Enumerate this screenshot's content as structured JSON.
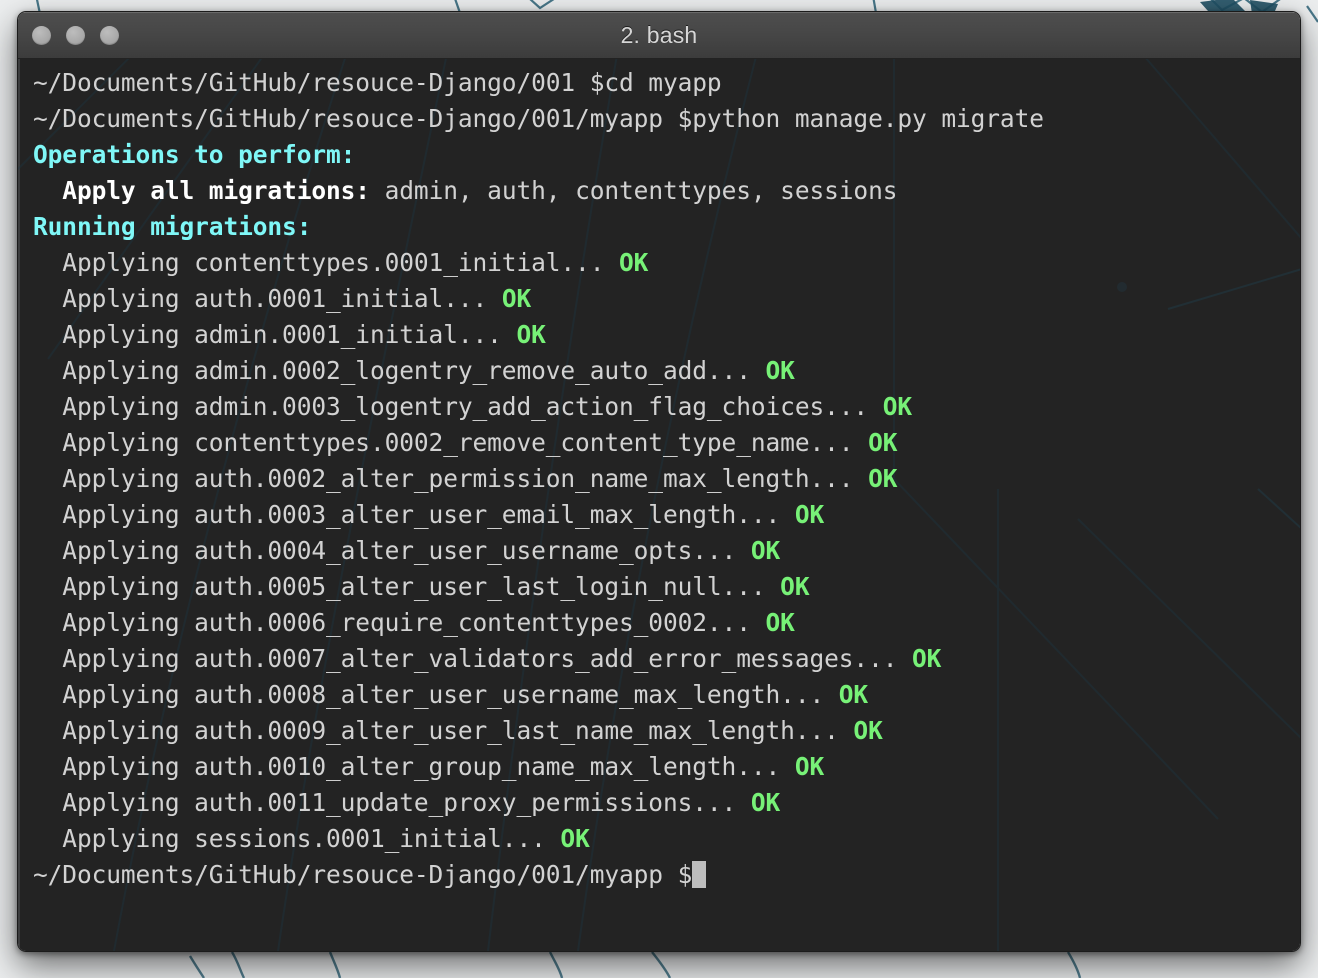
{
  "window": {
    "title": "2. bash",
    "controls": [
      {
        "name": "close-button",
        "label": "close"
      },
      {
        "name": "minimize-button",
        "label": "minimize"
      },
      {
        "name": "zoom-button",
        "label": "zoom"
      }
    ]
  },
  "colors": {
    "background": "#111111",
    "foreground": "#d2d2d2",
    "cyan": "#7ff7f7",
    "green": "#77f177",
    "bold_white": "#ffffff",
    "titlebar": "#474747",
    "cursor": "#bdbdbd"
  },
  "terminal": {
    "prompt_cwd_1": "~/Documents/GitHub/resouce-Django/001",
    "prompt_cwd_2": "~/Documents/GitHub/resouce-Django/001/myapp",
    "command_1": "$cd myapp",
    "command_2": "$python manage.py migrate",
    "lines": [
      {
        "segments": [
          {
            "text": "~/Documents/GitHub/resouce-Django/001 $cd myapp",
            "style": "default"
          }
        ]
      },
      {
        "segments": [
          {
            "text": "~/Documents/GitHub/resouce-Django/001/myapp $python manage.py migrate",
            "style": "default"
          }
        ]
      },
      {
        "segments": [
          {
            "text": "Operations to perform:",
            "style": "cyan"
          }
        ]
      },
      {
        "segments": [
          {
            "text": "  Apply all migrations:",
            "style": "bold"
          },
          {
            "text": " admin, auth, contenttypes, sessions",
            "style": "default"
          }
        ]
      },
      {
        "segments": [
          {
            "text": "Running migrations:",
            "style": "cyan"
          }
        ]
      },
      {
        "segments": [
          {
            "text": "  Applying contenttypes.0001_initial... ",
            "style": "default"
          },
          {
            "text": "OK",
            "style": "green"
          }
        ]
      },
      {
        "segments": [
          {
            "text": "  Applying auth.0001_initial... ",
            "style": "default"
          },
          {
            "text": "OK",
            "style": "green"
          }
        ]
      },
      {
        "segments": [
          {
            "text": "  Applying admin.0001_initial... ",
            "style": "default"
          },
          {
            "text": "OK",
            "style": "green"
          }
        ]
      },
      {
        "segments": [
          {
            "text": "  Applying admin.0002_logentry_remove_auto_add... ",
            "style": "default"
          },
          {
            "text": "OK",
            "style": "green"
          }
        ]
      },
      {
        "segments": [
          {
            "text": "  Applying admin.0003_logentry_add_action_flag_choices... ",
            "style": "default"
          },
          {
            "text": "OK",
            "style": "green"
          }
        ]
      },
      {
        "segments": [
          {
            "text": "  Applying contenttypes.0002_remove_content_type_name... ",
            "style": "default"
          },
          {
            "text": "OK",
            "style": "green"
          }
        ]
      },
      {
        "segments": [
          {
            "text": "  Applying auth.0002_alter_permission_name_max_length... ",
            "style": "default"
          },
          {
            "text": "OK",
            "style": "green"
          }
        ]
      },
      {
        "segments": [
          {
            "text": "  Applying auth.0003_alter_user_email_max_length... ",
            "style": "default"
          },
          {
            "text": "OK",
            "style": "green"
          }
        ]
      },
      {
        "segments": [
          {
            "text": "  Applying auth.0004_alter_user_username_opts... ",
            "style": "default"
          },
          {
            "text": "OK",
            "style": "green"
          }
        ]
      },
      {
        "segments": [
          {
            "text": "  Applying auth.0005_alter_user_last_login_null... ",
            "style": "default"
          },
          {
            "text": "OK",
            "style": "green"
          }
        ]
      },
      {
        "segments": [
          {
            "text": "  Applying auth.0006_require_contenttypes_0002... ",
            "style": "default"
          },
          {
            "text": "OK",
            "style": "green"
          }
        ]
      },
      {
        "segments": [
          {
            "text": "  Applying auth.0007_alter_validators_add_error_messages... ",
            "style": "default"
          },
          {
            "text": "OK",
            "style": "green"
          }
        ]
      },
      {
        "segments": [
          {
            "text": "  Applying auth.0008_alter_user_username_max_length... ",
            "style": "default"
          },
          {
            "text": "OK",
            "style": "green"
          }
        ]
      },
      {
        "segments": [
          {
            "text": "  Applying auth.0009_alter_user_last_name_max_length... ",
            "style": "default"
          },
          {
            "text": "OK",
            "style": "green"
          }
        ]
      },
      {
        "segments": [
          {
            "text": "  Applying auth.0010_alter_group_name_max_length... ",
            "style": "default"
          },
          {
            "text": "OK",
            "style": "green"
          }
        ]
      },
      {
        "segments": [
          {
            "text": "  Applying auth.0011_update_proxy_permissions... ",
            "style": "default"
          },
          {
            "text": "OK",
            "style": "green"
          }
        ]
      },
      {
        "segments": [
          {
            "text": "  Applying sessions.0001_initial... ",
            "style": "default"
          },
          {
            "text": "OK",
            "style": "green"
          }
        ]
      },
      {
        "segments": [
          {
            "text": "~/Documents/GitHub/resouce-Django/001/myapp $",
            "style": "default"
          },
          {
            "text": "",
            "style": "cursor"
          }
        ]
      }
    ]
  }
}
